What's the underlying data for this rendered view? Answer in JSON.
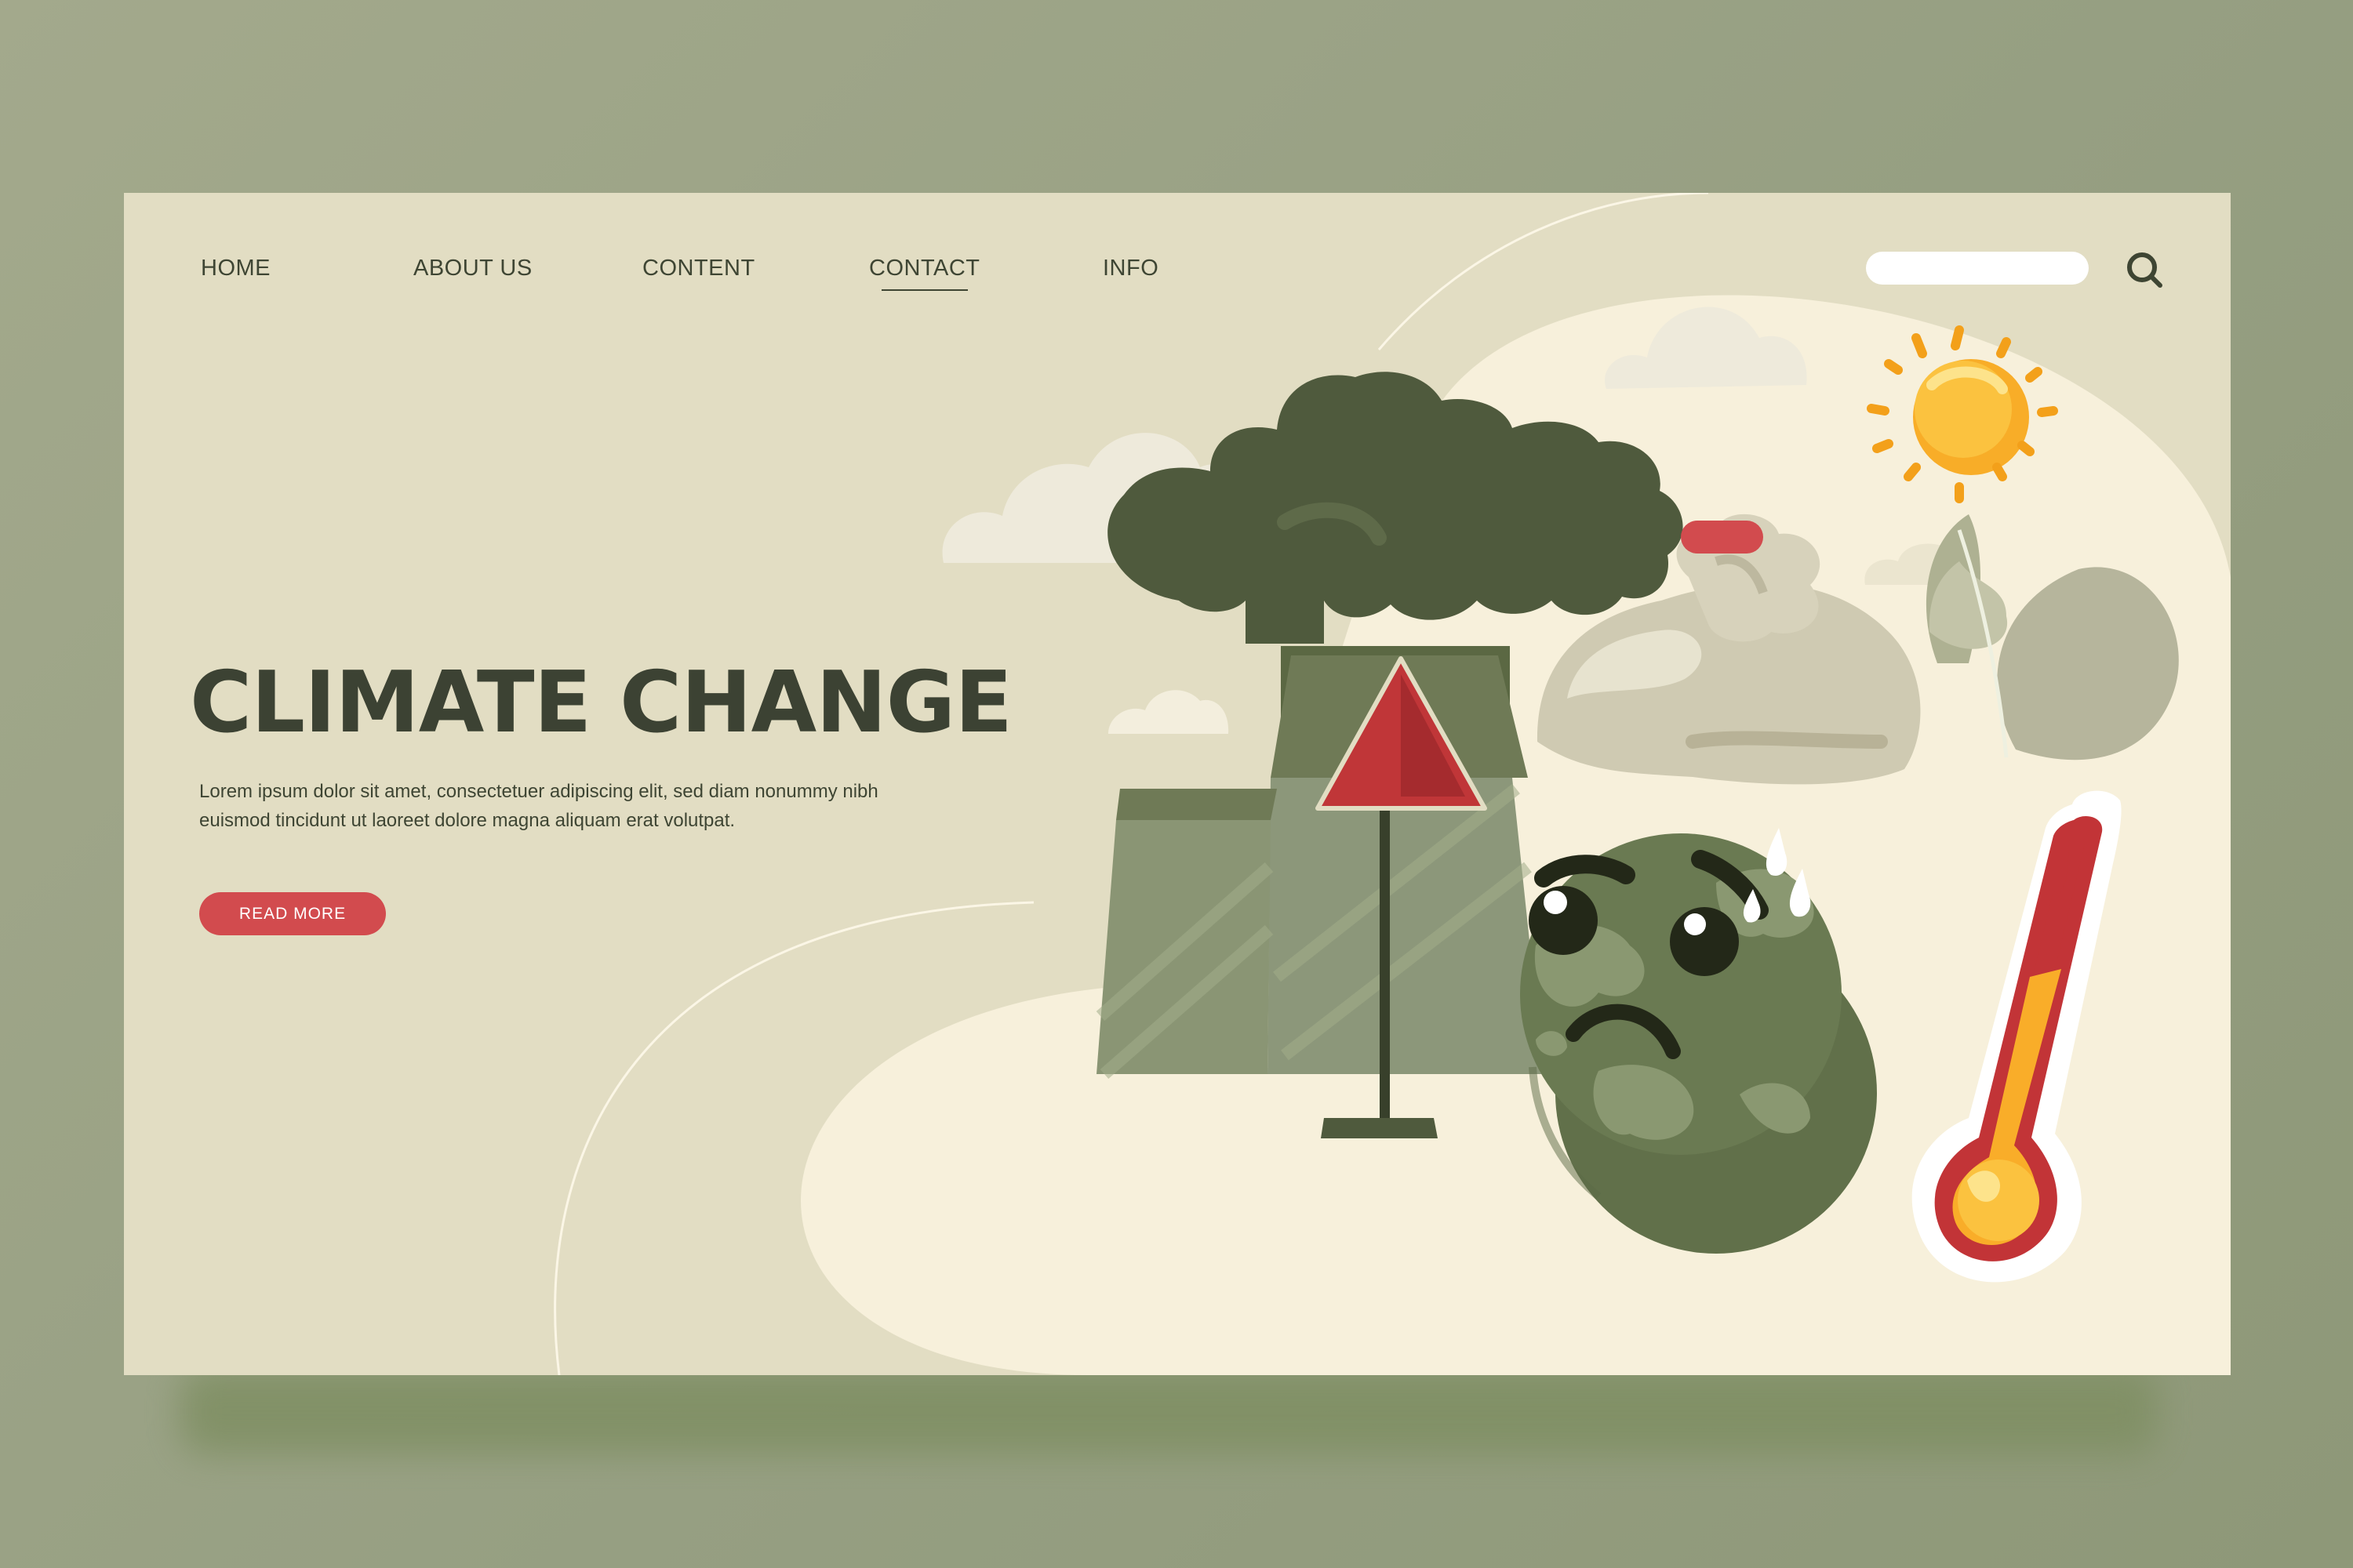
{
  "nav": {
    "items": [
      {
        "label": "HOME"
      },
      {
        "label": "ABOUT US"
      },
      {
        "label": "CONTENT"
      },
      {
        "label": "CONTACT",
        "active": true
      },
      {
        "label": "INFO"
      }
    ]
  },
  "search": {
    "placeholder": "",
    "value": "",
    "icon": "search-icon"
  },
  "hero": {
    "title": "CLIMATE CHANGE",
    "description": "Lorem ipsum dolor sit amet, consectetuer adipiscing elit, sed diam nonummy nibh euismod tincidunt ut laoreet dolore magna aliquam erat volutpat.",
    "button_label": "READ MORE"
  },
  "illustration": {
    "elements": [
      "factory-icon",
      "smoke-cloud-icon",
      "warning-sign-icon",
      "sad-earth-icon",
      "ice-bag-icon",
      "sun-icon",
      "thermometer-icon",
      "leaf-icon",
      "cloud-icon"
    ]
  },
  "colors": {
    "page_background": "#9aa285",
    "card_background": "#e2ddc3",
    "light_blob": "#f7f0db",
    "text": "#3e4533",
    "accent_red": "#d24b4e",
    "earth_green": "#6a7a52",
    "sun_yellow": "#f9bd35"
  }
}
